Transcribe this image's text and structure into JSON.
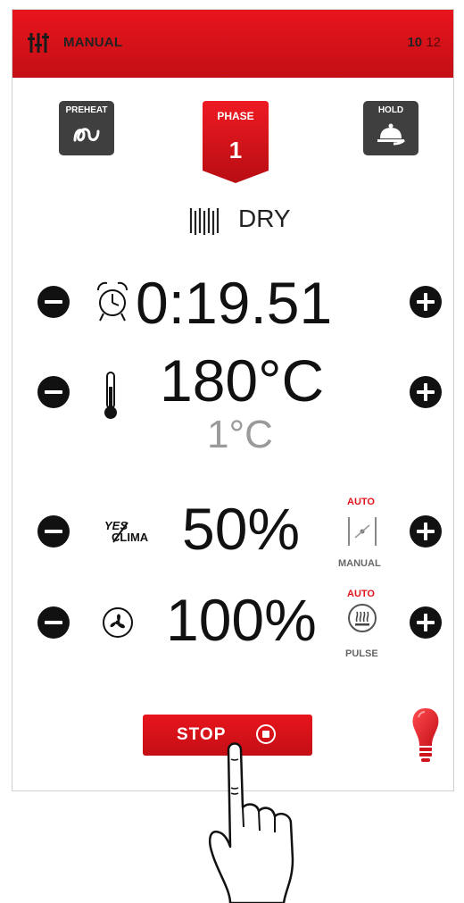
{
  "header": {
    "mode_label": "MANUAL",
    "page_current": "10",
    "page_total": "12",
    "icon": "sliders-icon"
  },
  "modes": {
    "preheat_label": "PREHEAT",
    "phase_label": "PHASE",
    "phase_number": "1",
    "hold_label": "HOLD"
  },
  "cooking": {
    "mode_label": "DRY",
    "icon": "dry-mode-icon"
  },
  "time": {
    "value": "0:19.51",
    "icon": "alarm-clock-icon"
  },
  "temperature": {
    "setpoint": "180°C",
    "core": "1°C",
    "icon": "thermometer-icon"
  },
  "climate": {
    "value": "50%",
    "icon_text_top": "YES",
    "icon_text_bottom": "CLIMA",
    "auto_label": "AUTO",
    "mode_label": "MANUAL"
  },
  "fan": {
    "value": "100%",
    "icon": "fan-icon",
    "auto_label": "AUTO",
    "mode_label": "PULSE"
  },
  "actions": {
    "stop_label": "STOP"
  },
  "colors": {
    "accent": "#e0141c",
    "dark_button": "#3f3f3f",
    "secondary_text": "#9a9a9a"
  }
}
